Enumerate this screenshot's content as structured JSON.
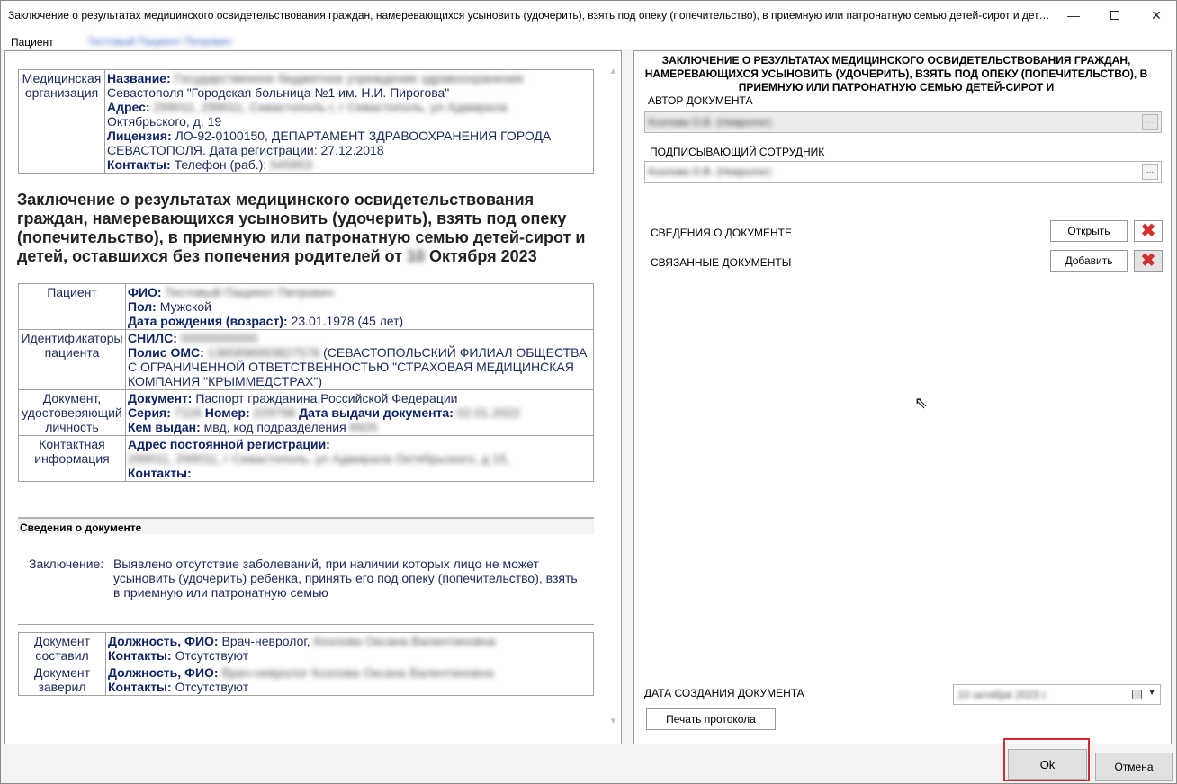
{
  "window": {
    "title": "Заключение о результатах медицинского освидетельствования граждан, намеревающихся усыновить (удочерить), взять под опеку (попечительство), в приемную или патронатную семью детей-сирот и дете..."
  },
  "patient_bar": {
    "label": "Пациент",
    "name": "Тестовый Пациент Петрович"
  },
  "left": {
    "org": {
      "header": "Медицинская организация",
      "name_key": "Название:",
      "name_val": "Государственное бюджетное учреждение здравоохранения",
      "name_val2": "Севастополя \"Городская больница №1 им. Н.И. Пирогова\"",
      "address_key": "Адрес:",
      "address_val": "299011, 299011, Севастополь г, г Севастополь, ул Адмирала",
      "address_val2": "Октябрьского, д. 19",
      "license_key": "Лицензия:",
      "license_val": "ЛО-92-0100150, ДЕПАРТАМЕНТ ЗДРАВООХРАНЕНИЯ ГОРОДА СЕВАСТОПОЛЯ. Дата регистрации: 27.12.2018",
      "contacts_key": "Контакты:",
      "contacts_val": "Телефон (раб.):",
      "contacts_phone": "545853"
    },
    "doc_title": "Заключение о результатах медицинского освидетельствования граждан, намеревающихся усыновить (удочерить), взять под опеку (попечительство), в приемную или патронатную семью детей-сирот и детей, оставшихся без попечения родителей от",
    "doc_title_day": "10",
    "doc_title_end": "Октября 2023",
    "patient": {
      "header": "Пациент",
      "fio_key": "ФИО:",
      "fio_val": "Тестовый Пациент Петрович",
      "sex_key": "Пол:",
      "sex_val": "Мужской",
      "dob_key": "Дата рождения (возраст):",
      "dob_val": "23.01.1978 (45 лет)"
    },
    "ids": {
      "header": "Идентификаторы пациента",
      "snils_key": "СНИЛС:",
      "snils_val": "00000000000",
      "oms_key": "Полис ОМС:",
      "oms_num": "1365896993827578",
      "oms_val": "(СЕВАСТОПОЛЬСКИЙ ФИЛИАЛ ОБЩЕСТВА С ОГРАНИЧЕННОЙ ОТВЕТСТВЕННОСТЬЮ \"СТРАХОВАЯ МЕДИЦИНСКАЯ КОМПАНИЯ \"КРЫММЕДСТРАХ\")"
    },
    "identity": {
      "header": "Документ, удостоверяющий личность",
      "doc_key": "Документ:",
      "doc_val": "Паспорт гражданина Российской Федерации",
      "series_key": "Серия:",
      "series_val": "7116",
      "number_key": "Номер:",
      "number_val": "229796",
      "issue_key": "Дата выдачи документа:",
      "issue_val": "02.01.2022",
      "issuer_key": "Кем выдан:",
      "issuer_val": "мвд, код подразделения",
      "issuer_code": "6925"
    },
    "contact": {
      "header": "Контактная информация",
      "addr_key": "Адрес постоянной регистрации:",
      "addr_val": "299011, 299011, г Севастополь, ул Адмирала Октябрьского, д 15,",
      "contacts_key": "Контакты:"
    },
    "section": "Сведения о документе",
    "conclusion_label": "Заключение:",
    "conclusion_text": "Выявлено отсутствие заболеваний, при наличии которых лицо не может усыновить (удочерить) ребенка, принять его под опеку (попечительство), взять в приемную или патронатную семью",
    "composed": {
      "header": "Документ составил",
      "pos_key": "Должность, ФИО:",
      "pos_val": "Врач-невролог,",
      "pos_name": "Козлова Оксана Валентиновна",
      "contacts_key": "Контакты:",
      "contacts_val": "Отсутствуют"
    },
    "verified": {
      "header": "Документ заверил",
      "pos_key": "Должность, ФИО:",
      "pos_val": "Врач-невролог Козлова Оксана Валентиновна",
      "contacts_key": "Контакты:",
      "contacts_val": "Отсутствуют"
    }
  },
  "right": {
    "title": "ЗАКЛЮЧЕНИЕ О РЕЗУЛЬТАТАХ МЕДИЦИНСКОГО ОСВИДЕТЕЛЬСТВОВАНИЯ ГРАЖДАН, НАМЕРЕВАЮЩИХСЯ УСЫНОВИТЬ (УДОЧЕРИТЬ), ВЗЯТЬ ПОД ОПЕКУ (ПОПЕЧИТЕЛЬСТВО), В ПРИЕМНУЮ ИЛИ ПАТРОНАТНУЮ СЕМЬЮ ДЕТЕЙ-СИРОТ И",
    "author_label": "АВТОР ДОКУМЕНТА",
    "author_val": "Козлова О.В. (Невролог)",
    "signer_label": "ПОДПИСЫВАЮЩИЙ СОТРУДНИК",
    "signer_val": "Козлова О.В. (Невролог)",
    "doc_info_label": "СВЕДЕНИЯ О ДОКУМЕНТЕ",
    "open_button": "Открыть",
    "related_label": "СВЯЗАННЫЕ ДОКУМЕНТЫ",
    "add_button": "Добавить",
    "created_label": "ДАТА СОЗДАНИЯ ДОКУМЕНТА",
    "created_val": "10 октября 2023 г.",
    "print_button": "Печать протокола",
    "ellipsis": "...",
    "cursor_glyph": "⇖"
  },
  "footer": {
    "ok": "Ok",
    "cancel": "Отмена"
  },
  "colors": {
    "accent_red": "#d62a2a",
    "text_blue": "#1d2a5c",
    "link_blue": "#3b5fc4"
  }
}
